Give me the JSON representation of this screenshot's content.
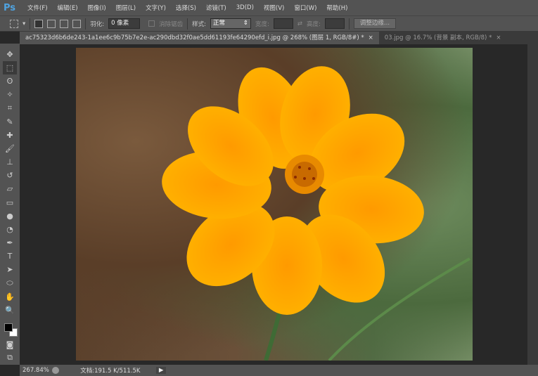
{
  "app": {
    "logo": "Ps"
  },
  "menu": [
    "文件(F)",
    "编辑(E)",
    "图像(I)",
    "图层(L)",
    "文字(Y)",
    "选择(S)",
    "滤镜(T)",
    "3D(D)",
    "视图(V)",
    "窗口(W)",
    "帮助(H)"
  ],
  "options": {
    "feather_label": "羽化:",
    "feather_value": "0 像素",
    "antialias_label": "消除锯齿",
    "style_label": "样式:",
    "style_value": "正常",
    "width_label": "宽度:",
    "height_label": "高度:",
    "refine_button": "调整边缘..."
  },
  "tabs": [
    {
      "label": "ac75323d6b6de243-1a1ee6c9b75b7e2e-ac290dbd32f0ae5dd61193fe64290efd_i.jpg @ 268% (图层 1, RGB/8#) *",
      "close": "×"
    },
    {
      "label": "03.jpg @ 16.7% (背景 副本, RGB/8) *",
      "close": "×"
    }
  ],
  "status": {
    "zoom": "267.84%",
    "doc": "文档:191.5 K/511.5K"
  }
}
